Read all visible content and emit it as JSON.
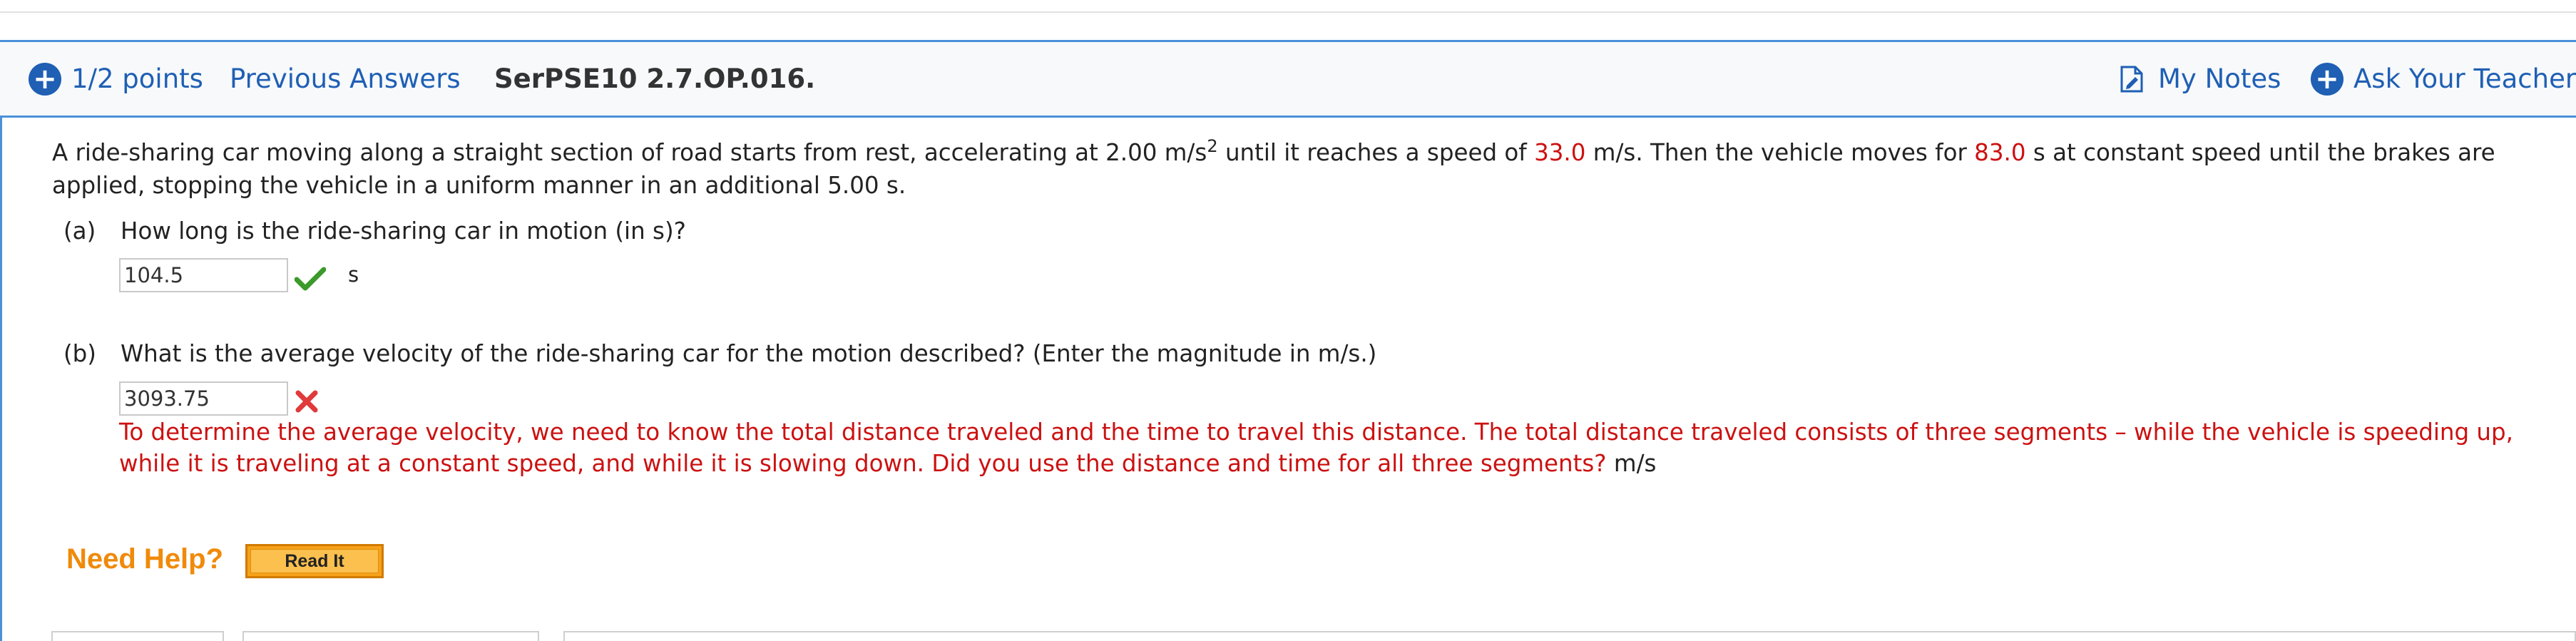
{
  "header": {
    "points_label": "1/2 points",
    "previous_answers_label": "Previous Answers",
    "problem_code": "SerPSE10 2.7.OP.016.",
    "my_notes_label": "My Notes",
    "ask_teacher_label": "Ask Your Teacher"
  },
  "problem": {
    "text_1": "A ride-sharing car moving along a straight section of road starts from rest, accelerating at 2.00 m/s",
    "sup": "2",
    "text_2": " until it reaches a speed of ",
    "speed": "33.0",
    "text_3": " m/s. Then the vehicle moves for ",
    "duration": "83.0",
    "text_4": " s at constant speed until the brakes are applied, stopping the vehicle in a uniform manner in an additional 5.00 s."
  },
  "part_a": {
    "label": "(a)",
    "question": "How long is the ride-sharing car in motion (in s)?",
    "answer": "104.5",
    "unit": "s",
    "status": "correct"
  },
  "part_b": {
    "label": "(b)",
    "question": "What is the average velocity of the ride-sharing car for the motion described? (Enter the magnitude in m/s.)",
    "answer": "3093.75",
    "status": "incorrect",
    "feedback": "To determine the average velocity, we need to know the total distance traveled and the time to travel this distance. The total distance traveled consists of three segments – while the vehicle is speeding up, while it is traveling at a constant speed, and while it is slowing down. Did you use the distance and time for all three segments?",
    "unit": "m/s"
  },
  "help": {
    "label": "Need Help?",
    "read_it_label": "Read It"
  },
  "colors": {
    "accent_blue": "#1f5fb4",
    "error_red": "#cc1111",
    "correct_green": "#3a9a2a",
    "help_orange": "#f08a0a"
  }
}
